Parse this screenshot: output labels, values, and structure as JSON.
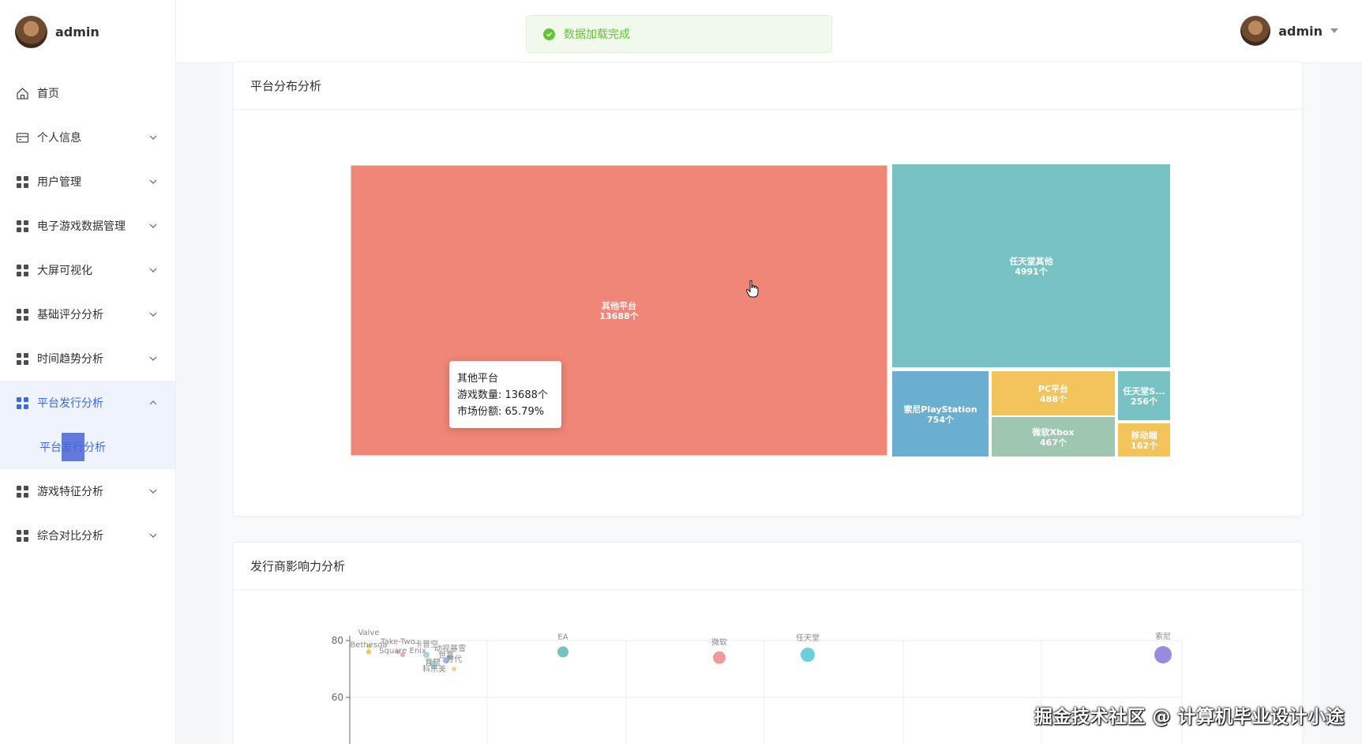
{
  "sidebar": {
    "user_name": "admin",
    "menu": [
      {
        "label": "首页",
        "icon": "home-icon"
      },
      {
        "label": "个人信息",
        "icon": "card-icon"
      },
      {
        "label": "用户管理",
        "icon": "grid-icon"
      },
      {
        "label": "电子游戏数据管理",
        "icon": "grid-icon"
      },
      {
        "label": "大屏可视化",
        "icon": "grid-icon"
      },
      {
        "label": "基础评分分析",
        "icon": "grid-icon"
      },
      {
        "label": "时间趋势分析",
        "icon": "grid-icon"
      },
      {
        "label": "平台发行分析",
        "icon": "grid-icon",
        "expanded": true
      },
      {
        "label": "游戏特征分析",
        "icon": "grid-icon"
      },
      {
        "label": "综合对比分析",
        "icon": "grid-icon"
      }
    ],
    "sub_item_label": "平台发行分析"
  },
  "header": {
    "toast_message": "数据加载完成",
    "user_name": "admin"
  },
  "cards": {
    "platform_title": "平台分布分析",
    "publisher_title": "发行商影响力分析"
  },
  "tooltip": {
    "name": "其他平台",
    "count_line": "游戏数量: 13688个",
    "share_line": "市场份额: 65.79%"
  },
  "watermark": "掘金技术社区 @ 计算机毕业设计小途",
  "colors": {
    "accent": "#3f6ad8",
    "success": "#67c23a",
    "tm_red": "#ef8677",
    "tm_teal": "#78c2c4",
    "tm_blue": "#6aaed0",
    "tm_yellow": "#f3c35c",
    "tm_green": "#9fc6b1"
  },
  "chart_data": [
    {
      "type": "treemap",
      "title": "平台分布分析",
      "items": [
        {
          "name": "其他平台",
          "value": 13688,
          "label": "13688个",
          "color": "#ef8677"
        },
        {
          "name": "任天堂其他",
          "value": 4991,
          "label": "4991个",
          "color": "#78c2c4"
        },
        {
          "name": "索尼PlayStation",
          "value": 754,
          "label": "754个",
          "color": "#6aaed0"
        },
        {
          "name": "PC平台",
          "value": 488,
          "label": "488个",
          "color": "#f3c35c"
        },
        {
          "name": "微软Xbox",
          "value": 467,
          "label": "467个",
          "color": "#9fc6b1"
        },
        {
          "name": "任天堂S...",
          "value": 256,
          "label": "256个",
          "color": "#78c2c4"
        },
        {
          "name": "移动端",
          "value": 162,
          "label": "162个",
          "color": "#f3c35c"
        }
      ]
    },
    {
      "type": "scatter",
      "title": "发行商影响力分析",
      "y_ticks": [
        60,
        80
      ],
      "points": [
        {
          "name": "EA",
          "y": 76,
          "color": "#78c2c4"
        },
        {
          "name": "微软",
          "y": 74,
          "color": "#f29a9a"
        },
        {
          "name": "任天堂",
          "y": 75,
          "color": "#6ad0dc"
        },
        {
          "name": "索尼",
          "y": 75,
          "color": "#9a8ae0"
        },
        {
          "name": "Valve",
          "y": 78,
          "color": "#e9d08c"
        },
        {
          "name": "Take-Two",
          "y": 76,
          "color": "#f2b8c2"
        },
        {
          "name": "Bethesda",
          "y": 76,
          "color": "#f3c35c"
        },
        {
          "name": "Square Enix",
          "y": 75,
          "color": "#f2a9b3"
        },
        {
          "name": "卡普空",
          "y": 75,
          "color": "#a7d6df"
        },
        {
          "name": "动视暴雪",
          "y": 74,
          "color": "#b6c8e8"
        },
        {
          "name": "世嘉",
          "y": 73,
          "color": "#9fb8e0"
        },
        {
          "name": "育碧",
          "y": 72,
          "color": "#b3e0c5"
        },
        {
          "name": "科乐美",
          "y": 71,
          "color": "#9ccbd6"
        },
        {
          "name": "万代",
          "y": 70,
          "color": "#f3d38c"
        }
      ]
    }
  ]
}
